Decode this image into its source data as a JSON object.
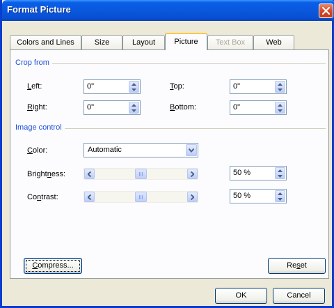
{
  "window": {
    "title": "Format Picture"
  },
  "tabs": [
    {
      "label": "Colors and Lines",
      "state": "normal"
    },
    {
      "label": "Size",
      "state": "normal"
    },
    {
      "label": "Layout",
      "state": "normal"
    },
    {
      "label": "Picture",
      "state": "active"
    },
    {
      "label": "Text Box",
      "state": "disabled"
    },
    {
      "label": "Web",
      "state": "normal"
    }
  ],
  "crop": {
    "title": "Crop from",
    "left_label": "Left:",
    "left_value": "0\"",
    "top_label": "Top:",
    "top_value": "0\"",
    "right_label": "Right:",
    "right_value": "0\"",
    "bottom_label": "Bottom:",
    "bottom_value": "0\""
  },
  "image_control": {
    "title": "Image control",
    "color_label": "Color:",
    "color_value": "Automatic",
    "brightness_label": "Brightness:",
    "brightness_value": "50 %",
    "brightness_level": 0.5,
    "contrast_label": "Contrast:",
    "contrast_value": "50 %",
    "contrast_level": 0.5
  },
  "buttons": {
    "compress": "Compress...",
    "reset": "Reset",
    "ok": "OK",
    "cancel": "Cancel"
  },
  "colors": {
    "title_bar": "#0a58dc",
    "group_title": "#1e4fd6",
    "close": "#d4482a"
  }
}
